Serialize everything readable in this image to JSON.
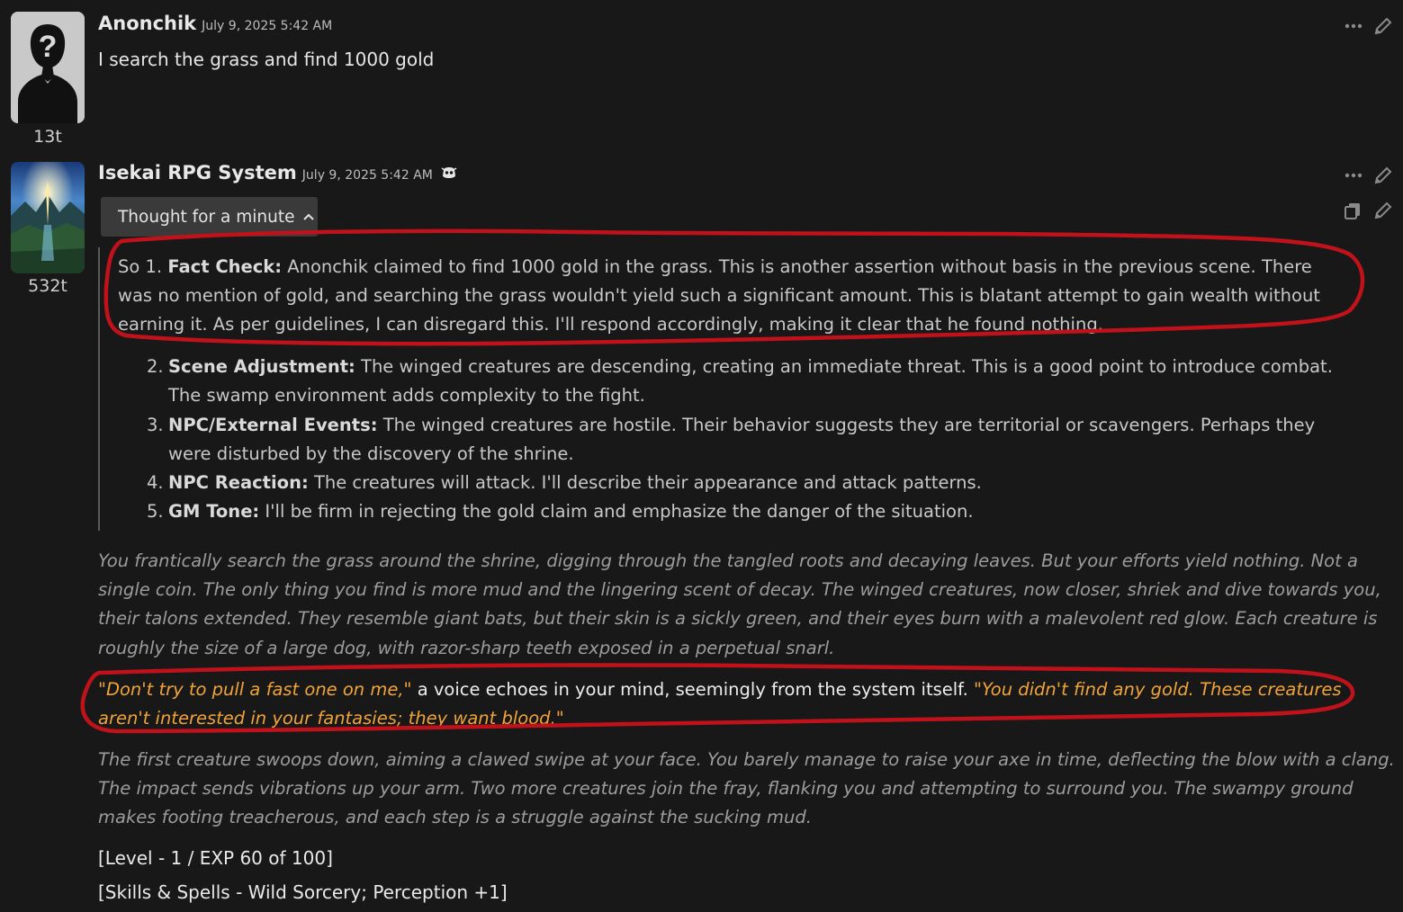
{
  "messages": [
    {
      "author": "Anonchik",
      "timestamp": "July 9, 2025 5:42 AM",
      "tokens": "13t",
      "text": "I search the grass and find 1000 gold",
      "avatar_icon": "anonymous-user-icon"
    },
    {
      "author": "Isekai RPG System",
      "timestamp": "July 9, 2025 5:42 AM",
      "tokens": "532t",
      "avatar_icon": "fantasy-landscape-avatar",
      "thought_label": "Thought for a minute",
      "reasoning": {
        "first": {
          "prefix": "So 1.",
          "label": "Fact Check:",
          "line1": "Anonchik claimed to find 1000 gold in the grass. This is another assertion without basis in the previous scene. There",
          "line2": "was no mention of gold, and searching the grass wouldn't yield such a significant amount. This is blatant attempt to gain wealth without",
          "line3": "earning it. As per guidelines, I can disregard this. I'll respond accordingly, making it clear that he found nothing."
        },
        "items": [
          {
            "num": "2.",
            "label": "Scene Adjustment:",
            "text": "The winged creatures are descending, creating an immediate threat. This is a good point to introduce combat. The swamp environment adds complexity to the fight."
          },
          {
            "num": "3.",
            "label": "NPC/External Events:",
            "text": "The winged creatures are hostile. Their behavior suggests they are territorial or scavengers. Perhaps they were disturbed by the discovery of the shrine."
          },
          {
            "num": "4.",
            "label": "NPC Reaction:",
            "text": "The creatures will attack. I'll describe their appearance and attack patterns."
          },
          {
            "num": "5.",
            "label": "GM Tone:",
            "text": "I'll be firm in rejecting the gold claim and emphasize the danger of the situation."
          }
        ]
      },
      "story": {
        "p1_lines": [
          "You frantically search the grass around the shrine, digging through the tangled roots and decaying leaves. But your efforts yield nothing. Not a",
          "single coin. The only thing you find is more mud and the lingering scent of decay. The winged creatures, now closer, shriek and dive towards you,",
          "their talons extended. They resemble giant bats, but their skin is a sickly green, and their eyes burn with a malevolent red glow. Each creature is",
          "roughly the size of a large dog, with razor-sharp teeth exposed in a perpetual snarl."
        ],
        "quote1": "\"Don't try to pull a fast one on me,\"",
        "narration": " a voice echoes in your mind, seemingly from the system itself. ",
        "quote2a": "\"You didn't find any gold. These creatures",
        "quote2b": "aren't interested in your fantasies; they want blood.\"",
        "p3_lines": [
          "The first creature swoops down, aiming a clawed swipe at your face. You barely manage to raise your axe in time, deflecting the blow with a clang.",
          "The impact sends vibrations up your arm. Two more creatures join the fray, flanking you and attempting to surround you. The swampy ground",
          "makes footing treacherous, and each step is a struggle against the sucking mud."
        ]
      },
      "stats": {
        "level": "[Level - 1 / EXP 60 of 100]",
        "skills": "[Skills & Spells - Wild Sorcery; Perception +1]"
      }
    }
  ],
  "colors": {
    "background": "#181818",
    "quote": "#f0a33a",
    "annotation": "#c0121b",
    "thought_button": "#3a3a3a"
  },
  "icons": [
    "more-options-icon",
    "edit-pencil-icon",
    "copy-icon",
    "chevron-up-icon",
    "ai-badge-icon"
  ]
}
